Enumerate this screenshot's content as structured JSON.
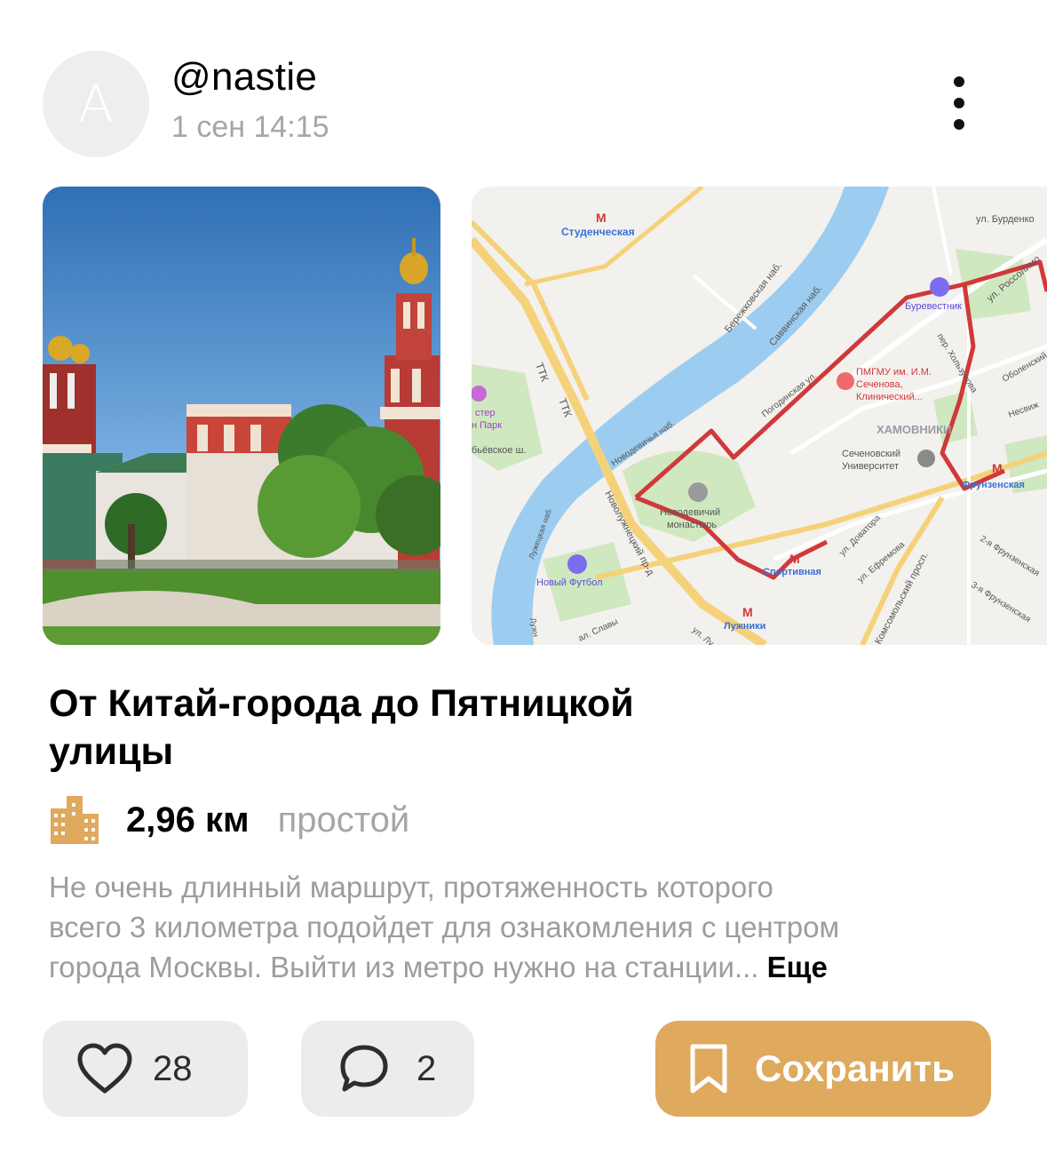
{
  "post": {
    "avatar_letter": "A",
    "username": "@nastie",
    "timestamp": "1 сен 14:15"
  },
  "route": {
    "title_line1": "От Китай-города до Пятницкой",
    "title_line2": "улицы",
    "distance": "2,96 км",
    "difficulty": "простой",
    "description_lines": [
      "Не очень длинный маршрут, протяженность которого",
      "всего 3 километра  подойдет для ознакомления с центром",
      "города Москвы. Выйти из метро нужно  на станции..."
    ],
    "more_label": "Еще"
  },
  "map_labels": {
    "studencheskaya": "Студенческая",
    "burdenko": "ул. Бурденко",
    "berezhkovskaya": "Бережковская наб.",
    "savvinskaya": "Саввинская наб.",
    "burevestnik": "Буревестник",
    "rossolimo": "ул. Россолимо",
    "ttk1": "ТТК",
    "ttk2": "ТТК",
    "pogodinskaya": "Погодинская ул.",
    "pmgmu1": "ПМГМУ им. И.М.",
    "pmgmu2": "Сеченова,",
    "pmgmu3": "Клинический...",
    "kholzunova": "пер. Хользунова",
    "obolenskiy": "Оболенский",
    "nesvizh": "Несвиж",
    "khamovniki": "ХАМОВНИКИ",
    "sechenov1": "Сеченовский",
    "sechenov2": "Университет",
    "frunzenskaya": "Фрунзенская",
    "novodevichya_nab": "Новодевичья наб.",
    "novodevichiy1": "Новодевичий",
    "novodevichiy2": "монастырь",
    "vorobyovskoe": "бьёвское ш.",
    "park1": "стер",
    "park2": "н Парк",
    "novoluzhnetskiy": "Новолужнецкий пр-д",
    "luzhetskaya": "Лужецкая наб.",
    "noviy_futbol": "Новый Футбол",
    "sportivnaya": "Спортивная",
    "dovatora": "ул. Доватора",
    "efremova": "ул. Ефремова",
    "komsomolskiy": "Комсомольский просп.",
    "frunz2": "2-я Фрунзенская",
    "frunz3": "3-я Фрунзенская",
    "luzhniki": "Лужники",
    "slavy": "ал. Славы",
    "ul_lu": "ул. Лу",
    "luzhn_edge": "Лужн"
  },
  "actions": {
    "likes": "28",
    "comments": "2",
    "save_label": "Сохранить"
  },
  "colors": {
    "accent": "#dfa95e",
    "muted_text": "#a6a6a6",
    "button_bg": "#ececec",
    "route_line": "#d0393a",
    "river": "#9ccdf0"
  },
  "icons": {
    "menu": "more-vertical-icon",
    "route_type": "buildings-icon",
    "like": "heart-icon",
    "comment": "comment-bubble-icon",
    "save": "bookmark-icon"
  }
}
